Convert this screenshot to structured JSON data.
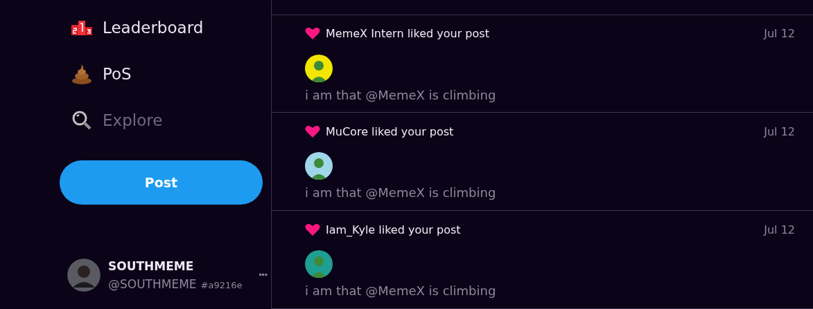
{
  "sidebar": {
    "nav_items": [
      {
        "label": "Leaderboard",
        "kind": "podium",
        "disabled": false
      },
      {
        "label": "PoS",
        "kind": "pile",
        "disabled": false
      },
      {
        "label": "Explore",
        "kind": "search",
        "disabled": true
      }
    ],
    "post_button": "Post",
    "account": {
      "name": "SOUTHMEME",
      "handle": "@SOUTHMEME",
      "tag": "#a9216e",
      "more": "•••"
    }
  },
  "notifications": [
    {
      "title": "MemeX Intern liked your post",
      "date": "Jul 12",
      "text": "i am that @MemeX is climbing"
    },
    {
      "title": "MuCore liked your post",
      "date": "Jul 12",
      "text": "i am that @MemeX is climbing"
    },
    {
      "title": "Iam_Kyle liked your post",
      "date": "Jul 12",
      "text": "i am that @MemeX is climbing"
    }
  ]
}
